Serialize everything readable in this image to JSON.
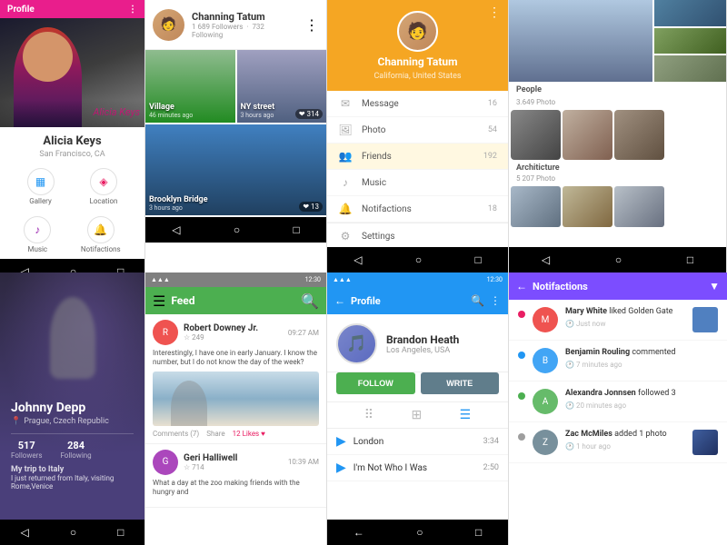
{
  "col1": {
    "screen1": {
      "header": "Profile",
      "name": "Alicia Keys",
      "location": "San Francisco, CA",
      "signature": "Alicia Keys",
      "icons": [
        {
          "label": "Gallery",
          "color": "#2196f3",
          "symbol": "▦"
        },
        {
          "label": "Location",
          "color": "#e91e63",
          "symbol": "📍"
        }
      ],
      "icons2": [
        {
          "label": "Music",
          "color": "#9c27b0",
          "symbol": "♪"
        },
        {
          "label": "Notifactions",
          "color": "#4caf50",
          "symbol": "🔔"
        }
      ]
    },
    "screen2": {
      "header": "Profile",
      "name": "Johnny Depp",
      "location": "Prague, Czech Republic",
      "followers": "517",
      "following": "284",
      "followers_label": "Followers",
      "following_label": "Following",
      "desc": "My trip to Italy",
      "desc2": "I just returned from Italy, visiting Rome,Venice"
    }
  },
  "col2": {
    "screen3": {
      "name": "Channing Tatum",
      "followers": "1 689 Followers",
      "following": "732 Following",
      "photos": [
        {
          "label": "Village",
          "time": "46 minutes ago",
          "type": "village"
        },
        {
          "label": "NY street",
          "time": "3 hours ago",
          "type": "nystreet",
          "likes": "314"
        },
        {
          "label": "Brooklyn Bridge",
          "time": "3 hours ago",
          "type": "brooklyn",
          "likes": "13"
        }
      ]
    },
    "screen4": {
      "title": "Feed",
      "time": "12:30",
      "posts": [
        {
          "name": "Robert Downey Jr.",
          "meta": "☆ 249",
          "time": "09:27 AM",
          "text": "Interestingly, I have one in early January. I know the number, but I do not know the day of the week?",
          "hasImage": true,
          "comments": "Comments (7)",
          "share": "Share",
          "likes": "12 Likes ♥"
        },
        {
          "name": "Geri Halliwell",
          "meta": "☆ 714",
          "time": "10:39 AM",
          "text": "What a day at the zoo making friends with the hungry and",
          "hasImage": false
        }
      ]
    }
  },
  "col3": {
    "screen5": {
      "name": "Channing Tatum",
      "location": "California, United States",
      "menu": [
        {
          "icon": "✉",
          "label": "Message",
          "count": "16"
        },
        {
          "icon": "🖼",
          "label": "Photo",
          "count": "54"
        },
        {
          "icon": "👥",
          "label": "Friends",
          "count": "192",
          "active": true
        },
        {
          "icon": "♪",
          "label": "Music",
          "count": ""
        },
        {
          "icon": "🔔",
          "label": "Notifactions",
          "count": "18"
        }
      ],
      "settings": "Settings"
    },
    "screen6": {
      "title": "Profile",
      "name": "Brandon Heath",
      "location": "Los Angeles, USA",
      "follow_label": "FOLLOW",
      "write_label": "WRITE",
      "time": "12:30",
      "songs": [
        {
          "name": "London",
          "duration": "3:34"
        },
        {
          "name": "I'm Not Who I Was",
          "duration": "2:50"
        }
      ]
    }
  },
  "col4": {
    "screen7": {
      "people_label": "People",
      "people_count": "3.649 Photo",
      "arch_label": "Architicture",
      "arch_count": "5 207 Photo"
    },
    "screen8": {
      "title": "Notifactions",
      "notifications": [
        {
          "dot_color": "#e91e63",
          "avatar_color": "#ef5350",
          "name": "Mary White",
          "action": "liked",
          "target": "Golden Gate",
          "time": "Just now",
          "has_thumb": true,
          "thumb_color": "#5080c0"
        },
        {
          "dot_color": "#2196f3",
          "avatar_color": "#42a5f5",
          "name": "Benjamin Rouling",
          "action": "commented",
          "target": "",
          "time": "7 minutes ago",
          "has_thumb": false
        },
        {
          "dot_color": "#4caf50",
          "avatar_color": "#66bb6a",
          "name": "Alexandra Jonnsen",
          "action": "followed 3",
          "target": "",
          "time": "20 minutes ago",
          "has_thumb": false
        },
        {
          "dot_color": "#9e9e9e",
          "avatar_color": "#78909c",
          "name": "Zac McMiles",
          "action": "added 1 photo",
          "target": "",
          "time": "1 hour ago",
          "has_thumb": true,
          "thumb_color": "#4060a0"
        }
      ]
    }
  }
}
